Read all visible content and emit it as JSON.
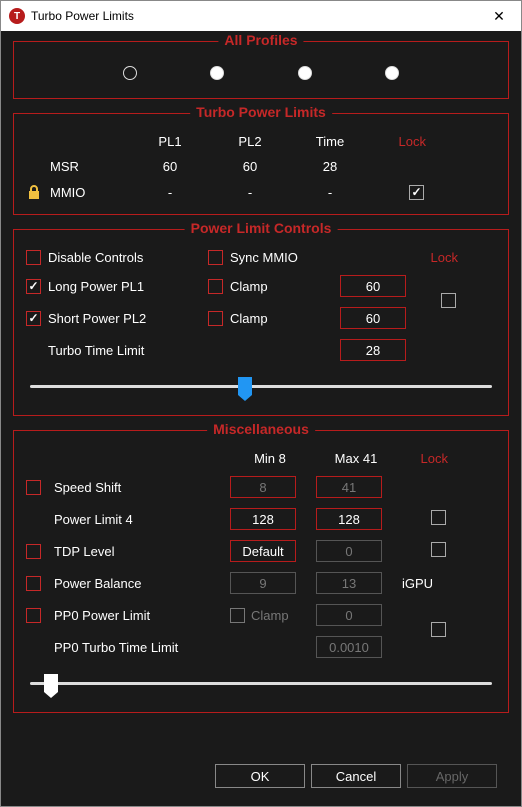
{
  "window": {
    "title": "Turbo Power Limits",
    "icon_letter": "T"
  },
  "sections": {
    "all_profiles": {
      "legend": "All Profiles",
      "selected_index": 0
    },
    "tpl": {
      "legend": "Turbo Power Limits",
      "headers": {
        "pl1": "PL1",
        "pl2": "PL2",
        "time": "Time",
        "lock": "Lock"
      },
      "rows": {
        "msr": {
          "label": "MSR",
          "pl1": "60",
          "pl2": "60",
          "time": "28",
          "locked": false,
          "lock_icon": false
        },
        "mmio": {
          "label": "MMIO",
          "pl1": "-",
          "pl2": "-",
          "time": "-",
          "locked": true,
          "lock_icon": true
        }
      }
    },
    "plc": {
      "legend": "Power Limit Controls",
      "lock_label": "Lock",
      "disable_controls": {
        "label": "Disable Controls",
        "checked": false
      },
      "sync_mmio": {
        "label": "Sync MMIO",
        "checked": false
      },
      "long_power": {
        "label": "Long Power PL1",
        "checked": true,
        "clamp_label": "Clamp",
        "clamp_checked": false,
        "value": "60"
      },
      "short_power": {
        "label": "Short Power PL2",
        "checked": true,
        "clamp_label": "Clamp",
        "clamp_checked": false,
        "value": "60"
      },
      "turbo_time": {
        "label": "Turbo Time Limit",
        "value": "28"
      },
      "lock_checked": false,
      "slider_pos_pct": 45
    },
    "misc": {
      "legend": "Miscellaneous",
      "lock_label": "Lock",
      "min_label": "Min  8",
      "max_label": "Max  41",
      "speed_shift": {
        "label": "Speed Shift",
        "checked": false,
        "min": "8",
        "max": "41",
        "min_disabled": true,
        "max_disabled": true
      },
      "power_limit4": {
        "label": "Power Limit 4",
        "min": "128",
        "max": "128",
        "lock_checked": false
      },
      "tdp_level": {
        "label": "TDP Level",
        "checked": false,
        "min": "Default",
        "max": "0",
        "max_disabled": true,
        "lock_checked": false
      },
      "power_balance": {
        "label": "Power Balance",
        "checked": false,
        "min": "9",
        "max": "13",
        "min_disabled": true,
        "max_disabled": true,
        "igpu_label": "iGPU"
      },
      "pp0_power": {
        "label": "PP0 Power Limit",
        "checked": false,
        "clamp_label": "Clamp",
        "clamp_checked": false,
        "max": "0",
        "max_disabled": true,
        "lock_checked": false
      },
      "pp0_time": {
        "label": "PP0 Turbo Time Limit",
        "value": "0.0010",
        "value_disabled": true
      },
      "slider_pos_pct": 3
    }
  },
  "buttons": {
    "ok": "OK",
    "cancel": "Cancel",
    "apply": "Apply"
  }
}
